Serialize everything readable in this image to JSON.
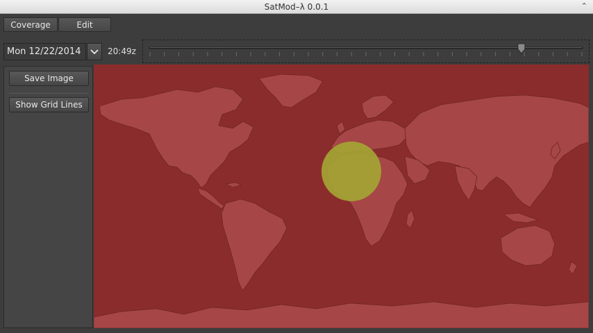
{
  "window": {
    "title": "SatMod–λ 0.0.1",
    "close_glyph": "⌃"
  },
  "menu": {
    "coverage_label": "Coverage",
    "edit_label": "Edit"
  },
  "toolbar": {
    "date_value": "Mon 12/22/2014",
    "time_label": "20:49z",
    "time_slider_fraction": 0.86
  },
  "sidebar": {
    "save_image_label": "Save Image",
    "show_grid_label": "Show Grid Lines"
  },
  "map": {
    "background_color": "#8b2c2c",
    "land_color": "#a64646",
    "coverage_color": "#a4a633"
  },
  "colors": {
    "panel": "#3d3d3d",
    "button_text": "#e6e6e6"
  }
}
